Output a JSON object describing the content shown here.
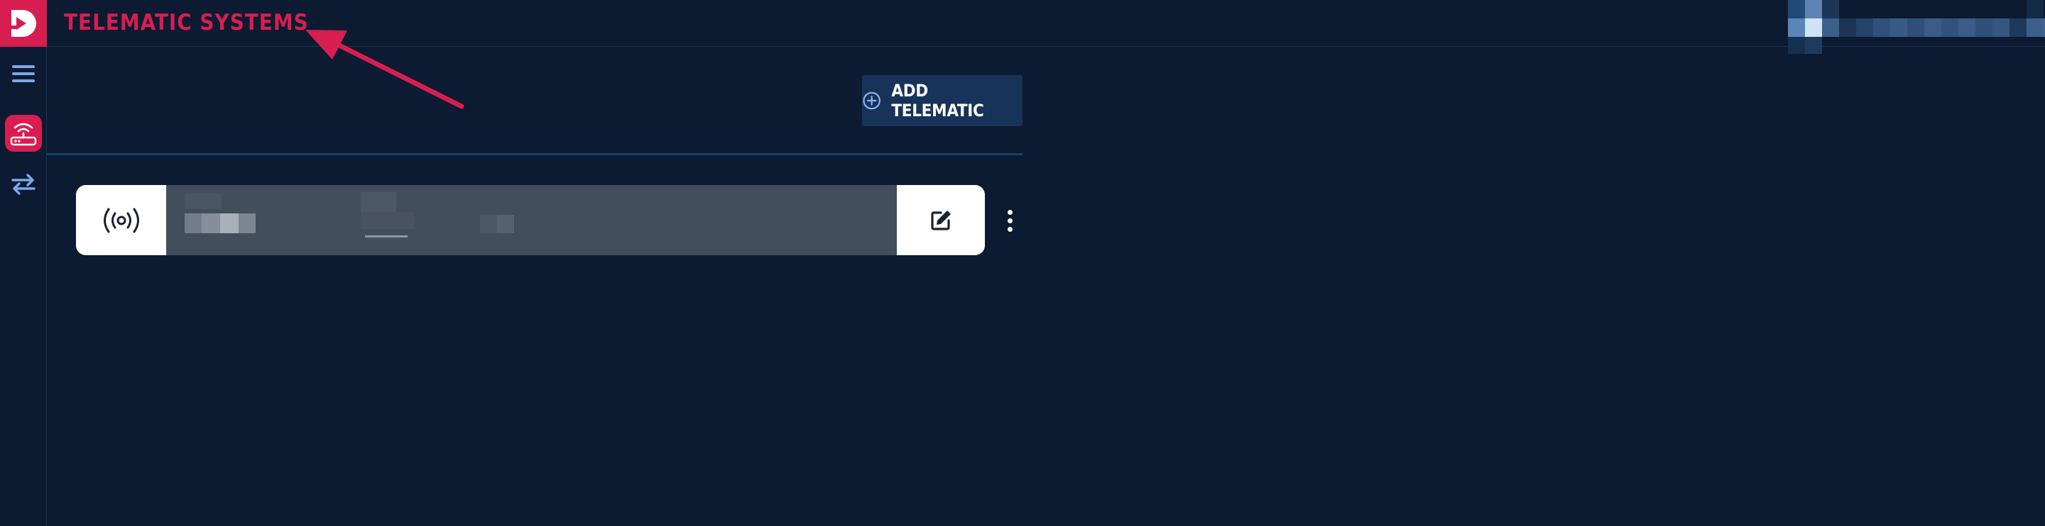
{
  "header": {
    "title": "TELEMATIC SYSTEMS",
    "account_blurred": true
  },
  "sidebar": {
    "items": [
      {
        "icon": "hamburger-menu-icon",
        "active": false
      },
      {
        "icon": "router-wifi-icon",
        "active": true
      },
      {
        "icon": "transfer-arrows-icon",
        "active": false
      }
    ]
  },
  "toolbar": {
    "add_label": "ADD TELEMATIC",
    "add_icon": "plus-circle-icon"
  },
  "telematics": [
    {
      "icon": "broadcast-signal-icon",
      "details_blurred": true,
      "actions": [
        "edit-icon",
        "more-vertical-icon"
      ]
    }
  ],
  "colors": {
    "background": "#0c1b31",
    "accent": "#d81d50",
    "button": "#17335a",
    "divider": "#1f3e66",
    "card_body": "#424e5c",
    "icon_blue": "#7da8e8"
  }
}
